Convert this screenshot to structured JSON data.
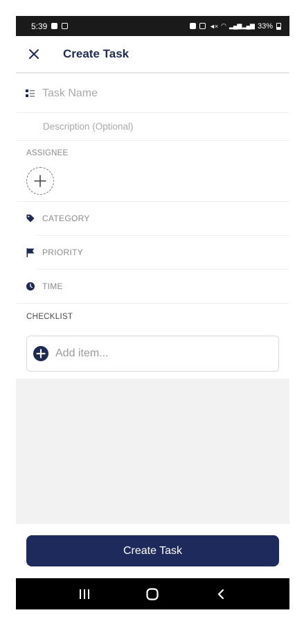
{
  "status_bar": {
    "time": "5:39",
    "battery": "33%"
  },
  "header": {
    "title": "Create Task"
  },
  "form": {
    "task_name_placeholder": "Task Name",
    "description_placeholder": "Description (Optional)",
    "assignee_label": "ASSIGNEE",
    "category_label": "CATEGORY",
    "priority_label": "PRIORITY",
    "time_label": "TIME",
    "checklist_label": "CHECKLIST",
    "add_item_placeholder": "Add item..."
  },
  "actions": {
    "create_label": "Create Task"
  },
  "icons": {
    "close": "close-icon",
    "task_name": "list-icon",
    "add_assignee": "plus-icon",
    "category": "tag-icon",
    "priority": "flag-icon",
    "time": "clock-icon",
    "add_item": "plus-circle-icon",
    "nav_recent": "recent-apps-icon",
    "nav_home": "home-icon",
    "nav_back": "back-icon"
  },
  "colors": {
    "primary": "#1f2a5c",
    "label_gray": "#8a8a8a",
    "placeholder": "#a9a9a9",
    "empty_area": "#f2f2f2"
  }
}
